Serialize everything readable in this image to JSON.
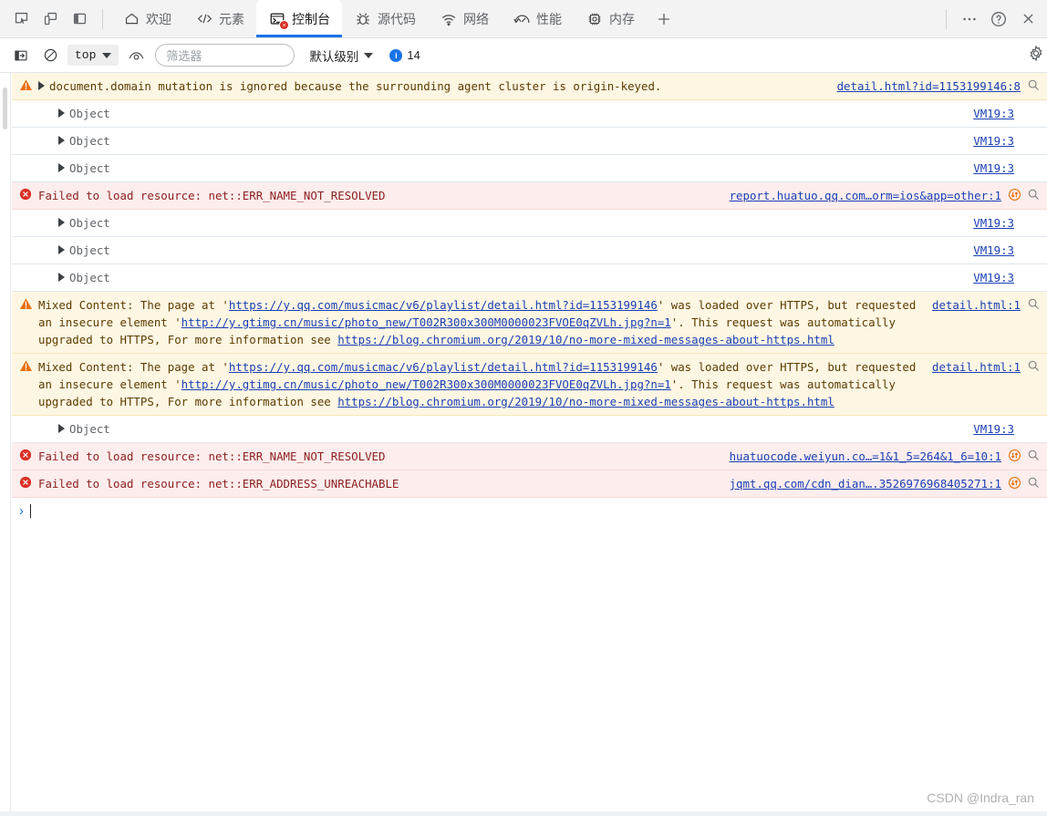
{
  "tabstrip": {
    "left_icons": [
      {
        "name": "inspect-element-icon",
        "label": "检查元素"
      },
      {
        "name": "device-toolbar-icon",
        "label": "设备模拟"
      },
      {
        "name": "dock-side-icon",
        "label": "停靠位置"
      }
    ],
    "tabs": [
      {
        "label": "欢迎",
        "icon": "home-icon",
        "active": false,
        "error_badge": ""
      },
      {
        "label": "元素",
        "icon": "code-icon",
        "active": false,
        "error_badge": ""
      },
      {
        "label": "控制台",
        "icon": "console-icon",
        "active": true,
        "error_badge": "×"
      },
      {
        "label": "源代码",
        "icon": "bug-icon",
        "active": false,
        "error_badge": ""
      },
      {
        "label": "网络",
        "icon": "wifi-icon",
        "active": false,
        "error_badge": ""
      },
      {
        "label": "性能",
        "icon": "gauge-icon",
        "active": false,
        "error_badge": ""
      },
      {
        "label": "内存",
        "icon": "chip-icon",
        "active": false,
        "error_badge": ""
      }
    ],
    "add_tab_label": "+",
    "more_label": "⋯",
    "help_label": "?",
    "close_label": "×"
  },
  "console_toolbar": {
    "sidebar_toggle": "console-sidebar-icon",
    "clear_console": "clear-console-icon",
    "context": "top",
    "eye_icon": "live-expression-icon",
    "filter_placeholder": "筛选器",
    "filter_value": "",
    "level": "默认级别",
    "message_count": "14",
    "settings_icon": "gear-icon"
  },
  "console_rows": [
    {
      "type": "warn",
      "icon": "warning-icon",
      "expandable": true,
      "text": "document.domain mutation is ignored because the surrounding agent cluster is origin-keyed.",
      "source": "detail.html?id=1153199146:8",
      "has_search_icon": true,
      "has_network_icon": false
    },
    {
      "type": "obj",
      "icon": "",
      "expandable": true,
      "text": "Object",
      "source": "VM19:3",
      "has_search_icon": false,
      "has_network_icon": false
    },
    {
      "type": "obj",
      "icon": "",
      "expandable": true,
      "text": "Object",
      "source": "VM19:3",
      "has_search_icon": false,
      "has_network_icon": false
    },
    {
      "type": "obj",
      "icon": "",
      "expandable": true,
      "text": "Object",
      "source": "VM19:3",
      "has_search_icon": false,
      "has_network_icon": false
    },
    {
      "type": "err",
      "icon": "error-icon",
      "expandable": false,
      "text": "Failed to load resource: net::ERR_NAME_NOT_RESOLVED",
      "source": "report.huatuo.qq.com…orm=ios&app=other:1",
      "has_search_icon": true,
      "has_network_icon": true
    },
    {
      "type": "obj",
      "icon": "",
      "expandable": true,
      "text": "Object",
      "source": "VM19:3",
      "has_search_icon": false,
      "has_network_icon": false
    },
    {
      "type": "obj",
      "icon": "",
      "expandable": true,
      "text": "Object",
      "source": "VM19:3",
      "has_search_icon": false,
      "has_network_icon": false
    },
    {
      "type": "obj",
      "icon": "",
      "expandable": true,
      "text": "Object",
      "source": "VM19:3",
      "has_search_icon": false,
      "has_network_icon": false
    },
    {
      "type": "warn-mixed",
      "icon": "warning-icon",
      "expandable": false,
      "segments": [
        {
          "t": "Mixed Content: The page at '",
          "link": false
        },
        {
          "t": "https://y.qq.com/musicmac/v6/playlist/detail.html?id=1153199146",
          "link": true
        },
        {
          "t": "' was loaded over HTTPS, but requested an insecure element '",
          "link": false
        },
        {
          "t": "http://y.gtimg.cn/music/photo_new/T002R300x300M0000023FVOE0qZVLh.jpg?n=1",
          "link": true
        },
        {
          "t": "'. This request was automatically upgraded to HTTPS, For more information see ",
          "link": false
        },
        {
          "t": "https://blog.chromium.org/2019/10/no-more-mixed-messages-about-https.html",
          "link": true
        }
      ],
      "source": "detail.html:1",
      "has_search_icon": true,
      "has_network_icon": false
    },
    {
      "type": "warn-mixed",
      "icon": "warning-icon",
      "expandable": false,
      "segments": [
        {
          "t": "Mixed Content: The page at '",
          "link": false
        },
        {
          "t": "https://y.qq.com/musicmac/v6/playlist/detail.html?id=1153199146",
          "link": true
        },
        {
          "t": "' was loaded over HTTPS, but requested an insecure element '",
          "link": false
        },
        {
          "t": "http://y.gtimg.cn/music/photo_new/T002R300x300M0000023FVOE0qZVLh.jpg?n=1",
          "link": true
        },
        {
          "t": "'. This request was automatically upgraded to HTTPS, For more information see ",
          "link": false
        },
        {
          "t": "https://blog.chromium.org/2019/10/no-more-mixed-messages-about-https.html",
          "link": true
        }
      ],
      "source": "detail.html:1",
      "has_search_icon": true,
      "has_network_icon": false
    },
    {
      "type": "obj",
      "icon": "",
      "expandable": true,
      "text": "Object",
      "source": "VM19:3",
      "has_search_icon": false,
      "has_network_icon": false
    },
    {
      "type": "err",
      "icon": "error-icon",
      "expandable": false,
      "text": "Failed to load resource: net::ERR_NAME_NOT_RESOLVED",
      "source": "huatuocode.weiyun.co…=1&1_5=264&1_6=10:1",
      "has_search_icon": true,
      "has_network_icon": true
    },
    {
      "type": "err",
      "icon": "error-icon",
      "expandable": false,
      "text": "Failed to load resource: net::ERR_ADDRESS_UNREACHABLE",
      "source": "jqmt.qq.com/cdn_dian….3526976968405271:1",
      "has_search_icon": true,
      "has_network_icon": true
    }
  ],
  "prompt": {
    "chevron": "›",
    "value": ""
  },
  "watermark": "CSDN @Indra_ran",
  "colors": {
    "accent": "#1a73e8",
    "warn_bg": "#fdf6e3",
    "err_bg": "#fdeded",
    "link": "#1a3fb4",
    "error_red": "#d93025",
    "warn_orange": "#e8710a"
  }
}
